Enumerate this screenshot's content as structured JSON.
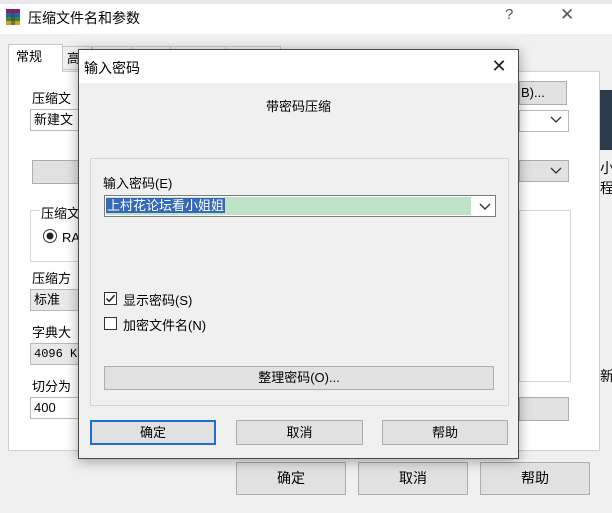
{
  "background_window": {
    "title": "压缩文件名和参数",
    "help_glyph": "?",
    "close_glyph": "✕",
    "tabs": [
      "常规",
      "高"
    ],
    "archive_name_label": "压缩文",
    "archive_name_value": "新建文",
    "browse_label": "B)...",
    "format_group_label": "压缩文",
    "format_rar_label": "RA",
    "method_label": "压缩方",
    "method_value": "标准",
    "dict_label": "字典大",
    "dict_value": "4096 K",
    "split_label": "切分为",
    "split_value": "400",
    "buttons": {
      "ok": "确定",
      "cancel": "取消",
      "help": "帮助"
    },
    "right_strip_chars": [
      "小",
      "程",
      "新"
    ]
  },
  "dialog": {
    "title": "输入密码",
    "close_glyph": "✕",
    "heading": "带密码压缩",
    "password_label": "输入密码(E)",
    "password_value": "上村花论坛看小姐姐",
    "show_password_label": "显示密码(S)",
    "show_password_checked": true,
    "encrypt_filenames_label": "加密文件名(N)",
    "encrypt_filenames_checked": false,
    "organize_button": "整理密码(O)...",
    "buttons": {
      "ok": "确定",
      "cancel": "取消",
      "help": "帮助"
    }
  }
}
